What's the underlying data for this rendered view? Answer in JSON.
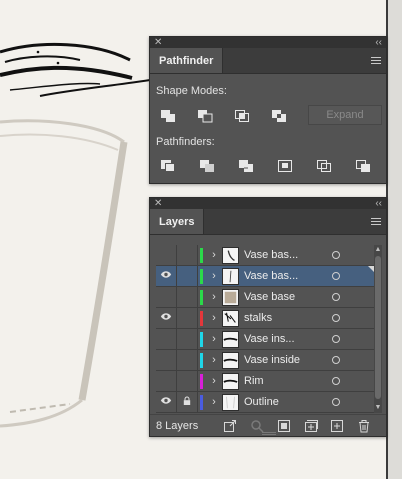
{
  "pathfinder_panel": {
    "tab_label": "Pathfinder",
    "shape_modes_label": "Shape Modes:",
    "pathfinders_label": "Pathfinders:",
    "expand_label": "Expand",
    "shape_mode_icons": [
      "unite-icon",
      "minus-front-icon",
      "intersect-icon",
      "exclude-icon"
    ],
    "pathfinder_icons": [
      "divide-icon",
      "trim-icon",
      "merge-icon",
      "crop-icon",
      "outline-icon",
      "minus-back-icon"
    ]
  },
  "layers_panel": {
    "tab_label": "Layers",
    "layer_count": "8 Layers",
    "layers": [
      {
        "name": "Vase bas...",
        "color": "#2bd94a",
        "visible": false,
        "locked": false,
        "selected": false,
        "thumb": "stroke"
      },
      {
        "name": "Vase bas...",
        "color": "#2bd94a",
        "visible": true,
        "locked": false,
        "selected": true,
        "thumb": "line"
      },
      {
        "name": "Vase base",
        "color": "#2bd94a",
        "visible": false,
        "locked": false,
        "selected": false,
        "thumb": "fill"
      },
      {
        "name": "stalks",
        "color": "#e5373b",
        "visible": true,
        "locked": false,
        "selected": false,
        "thumb": "stalks"
      },
      {
        "name": "Vase ins...",
        "color": "#1fd6e8",
        "visible": false,
        "locked": false,
        "selected": false,
        "thumb": "dash"
      },
      {
        "name": "Vase inside",
        "color": "#1fd6e8",
        "visible": false,
        "locked": false,
        "selected": false,
        "thumb": "dash"
      },
      {
        "name": "Rim",
        "color": "#d91fd9",
        "visible": false,
        "locked": false,
        "selected": false,
        "thumb": "dash"
      },
      {
        "name": "Outline",
        "color": "#4a5ce0",
        "visible": true,
        "locked": true,
        "selected": false,
        "thumb": "outline"
      }
    ],
    "footer_icons": [
      "export-icon",
      "locate-object-icon",
      "make-clipping-mask-icon",
      "create-sublayer-icon",
      "create-new-layer-icon",
      "delete-layer-icon"
    ]
  }
}
